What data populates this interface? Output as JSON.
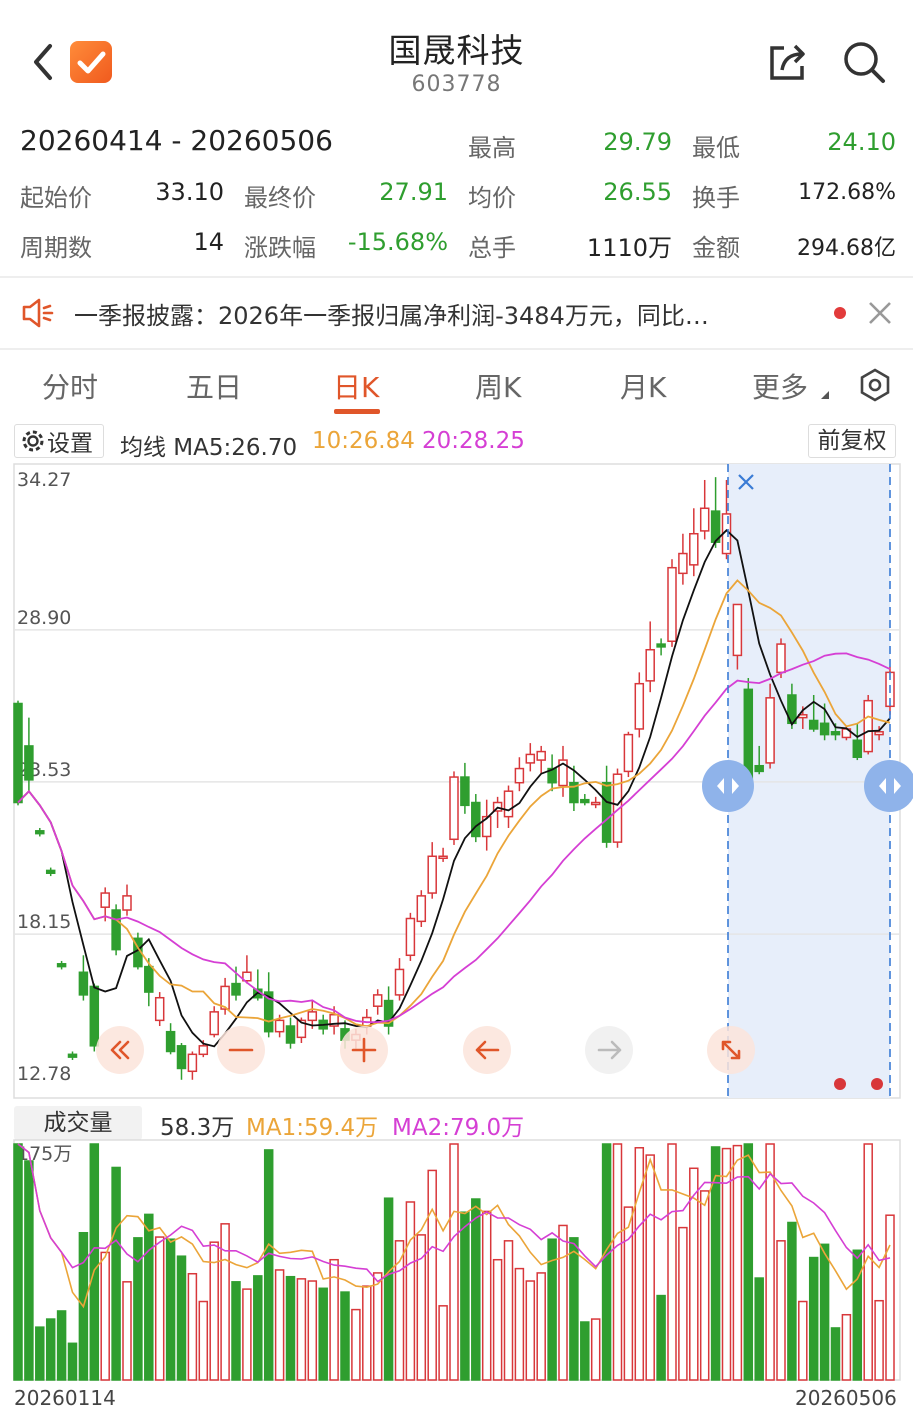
{
  "header": {
    "title": "国晟科技",
    "code": "603778",
    "back_icon": "chevron-left-icon",
    "share_icon": "share-icon",
    "search_icon": "search-icon"
  },
  "summary": {
    "date_range": "20260414  -  20260506",
    "high_label": "最高",
    "high": "29.79",
    "low_label": "最低",
    "low": "24.10",
    "open_label": "起始价",
    "open": "33.10",
    "close_label": "最终价",
    "close": "27.91",
    "avg_label": "均价",
    "avg": "26.55",
    "turnover_label": "换手",
    "turnover": "172.68%",
    "periods_label": "周期数",
    "periods": "14",
    "change_label": "涨跌幅",
    "change": "-15.68%",
    "volume_label": "总手",
    "volume": "1110万",
    "amount_label": "金额",
    "amount": "294.68亿"
  },
  "notice": {
    "text": "一季报披露：2026年一季报归属净利润-3484万元，同比…",
    "icon": "speaker-icon"
  },
  "tabs": [
    "分时",
    "五日",
    "日K",
    "周K",
    "月K",
    "更多"
  ],
  "active_tab": 2,
  "ma_bar": {
    "settings": "设置",
    "ma5": "均线 MA5:26.70",
    "ma10": "10:26.84",
    "ma20": "20:28.25",
    "adjust": "前复权"
  },
  "vol_bar": {
    "label": "成交量",
    "value": "58.3万",
    "ma1": "MA1:59.4万",
    "ma2": "MA2:79.0万",
    "max_label": "175万"
  },
  "colors": {
    "up": "#d8373a",
    "down": "#2f9e2f",
    "ma5": "#111111",
    "ma10": "#eba539",
    "ma20": "#d53fd4",
    "accent": "#e0562a"
  },
  "chart_data": {
    "type": "candlestick",
    "y_ticks": [
      "34.27",
      "28.90",
      "23.53",
      "18.15",
      "12.78"
    ],
    "ylim": [
      12.78,
      34.27
    ],
    "x_start": "20260114",
    "x_end": "20260506",
    "candles": [
      [
        26.3,
        22.8,
        26.4,
        22.7
      ],
      [
        24.8,
        23.6,
        25.8,
        23.2
      ],
      [
        21.8,
        21.7,
        21.9,
        21.6
      ],
      [
        20.4,
        20.3,
        20.5,
        20.2
      ],
      [
        17.1,
        17.0,
        17.2,
        16.9
      ],
      [
        13.9,
        13.8,
        14.0,
        13.7
      ],
      [
        16.8,
        16.0,
        17.4,
        15.8
      ],
      [
        16.3,
        14.2,
        16.4,
        14.0
      ],
      [
        19.1,
        19.6,
        19.8,
        18.6
      ],
      [
        19.0,
        17.6,
        19.2,
        17.4
      ],
      [
        19.0,
        19.5,
        19.9,
        18.8
      ],
      [
        18.0,
        17.0,
        18.2,
        16.9
      ],
      [
        17.0,
        16.1,
        17.3,
        15.6
      ],
      [
        15.1,
        15.9,
        16.1,
        14.9
      ],
      [
        14.7,
        14.0,
        15.0,
        13.9
      ],
      [
        14.2,
        13.4,
        14.3,
        13.0
      ],
      [
        13.3,
        13.9,
        14.0,
        13.0
      ],
      [
        13.9,
        14.2,
        14.4,
        13.8
      ],
      [
        14.6,
        15.4,
        15.6,
        14.5
      ],
      [
        15.5,
        16.3,
        16.6,
        15.3
      ],
      [
        16.4,
        16.0,
        17.0,
        15.8
      ],
      [
        16.5,
        16.8,
        17.4,
        16.4
      ],
      [
        16.2,
        15.9,
        16.9,
        15.8
      ],
      [
        16.1,
        14.7,
        16.8,
        14.5
      ],
      [
        14.7,
        15.1,
        15.3,
        14.5
      ],
      [
        14.9,
        14.3,
        15.2,
        14.1
      ],
      [
        14.5,
        15.1,
        15.2,
        14.3
      ],
      [
        15.1,
        15.4,
        15.8,
        14.8
      ],
      [
        15.1,
        14.8,
        15.3,
        14.6
      ],
      [
        14.9,
        15.3,
        15.6,
        14.6
      ],
      [
        14.8,
        14.4,
        15.1,
        14.1
      ],
      [
        14.4,
        14.6,
        14.8,
        14.1
      ],
      [
        14.9,
        15.2,
        15.5,
        14.6
      ],
      [
        15.6,
        16.0,
        16.2,
        15.3
      ],
      [
        15.8,
        14.9,
        16.3,
        14.6
      ],
      [
        16.0,
        16.9,
        17.3,
        15.8
      ],
      [
        17.4,
        18.7,
        18.9,
        17.2
      ],
      [
        18.6,
        19.5,
        19.7,
        18.4
      ],
      [
        19.6,
        20.9,
        21.4,
        19.4
      ],
      [
        20.9,
        20.9,
        21.2,
        20.7
      ],
      [
        21.5,
        23.7,
        23.9,
        21.3
      ],
      [
        23.7,
        22.7,
        24.2,
        22.4
      ],
      [
        22.8,
        21.6,
        23.1,
        21.4
      ],
      [
        21.6,
        22.3,
        22.9,
        21.1
      ],
      [
        22.5,
        22.8,
        23.0,
        21.9
      ],
      [
        22.3,
        23.2,
        23.4,
        21.9
      ],
      [
        23.5,
        24.0,
        24.4,
        23.2
      ],
      [
        24.2,
        24.5,
        24.9,
        23.9
      ],
      [
        24.3,
        24.6,
        24.8,
        23.8
      ],
      [
        24.0,
        23.5,
        24.5,
        23.2
      ],
      [
        23.4,
        24.3,
        24.8,
        23.0
      ],
      [
        23.5,
        22.8,
        24.1,
        22.5
      ],
      [
        22.9,
        22.8,
        23.1,
        22.7
      ],
      [
        22.8,
        22.8,
        23.0,
        22.6
      ],
      [
        23.5,
        21.4,
        24.1,
        21.2
      ],
      [
        21.4,
        23.8,
        24.0,
        21.2
      ],
      [
        23.9,
        25.2,
        25.3,
        23.7
      ],
      [
        25.4,
        27.0,
        27.4,
        25.1
      ],
      [
        27.1,
        28.2,
        29.2,
        26.7
      ],
      [
        28.4,
        28.3,
        28.6,
        28.0
      ],
      [
        28.5,
        31.1,
        31.4,
        28.3
      ],
      [
        30.9,
        31.6,
        32.3,
        30.5
      ],
      [
        31.2,
        32.3,
        33.2,
        30.8
      ],
      [
        32.4,
        33.2,
        34.2,
        32.1
      ],
      [
        33.1,
        32.0,
        34.3,
        31.8
      ],
      [
        31.6,
        33.0,
        34.2,
        31.4
      ],
      [
        28.0,
        29.8,
        29.8,
        27.5
      ],
      [
        26.8,
        23.4,
        27.2,
        23.2
      ],
      [
        24.1,
        23.9,
        24.8,
        23.8
      ],
      [
        24.2,
        26.5,
        27.0,
        24.0
      ],
      [
        27.4,
        28.4,
        28.6,
        27.2
      ],
      [
        26.6,
        25.6,
        27.0,
        25.4
      ],
      [
        25.8,
        25.9,
        26.2,
        25.4
      ],
      [
        25.7,
        25.4,
        26.6,
        25.3
      ],
      [
        25.6,
        25.2,
        26.3,
        25.0
      ],
      [
        25.3,
        25.2,
        25.6,
        25.0
      ],
      [
        25.1,
        25.4,
        25.5,
        25.0
      ],
      [
        25.0,
        24.4,
        25.6,
        24.3
      ],
      [
        24.6,
        26.4,
        26.6,
        24.5
      ],
      [
        25.2,
        25.3,
        25.5,
        25.0
      ],
      [
        26.2,
        27.4,
        27.6,
        25.9
      ]
    ],
    "ma_lines": [
      "MA5",
      "MA10",
      "MA20"
    ],
    "volume_max": 175,
    "volume_unit": "万"
  },
  "nav_buttons": [
    "double-left-icon",
    "minus-icon",
    "plus-icon",
    "arrow-left-icon",
    "arrow-right-icon",
    "expand-icon"
  ]
}
